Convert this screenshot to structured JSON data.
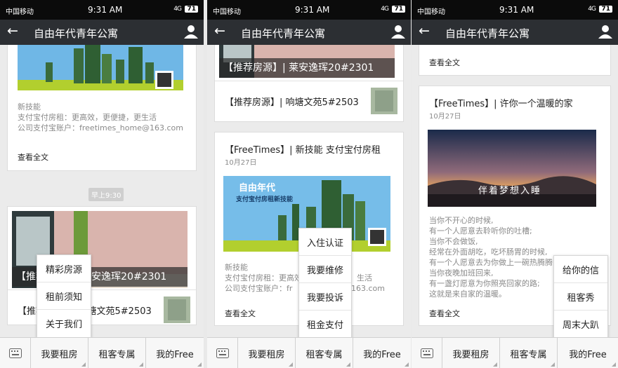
{
  "status": {
    "carrier": "中国移动",
    "time": "9:31 AM",
    "signal": "4G",
    "battery": "71"
  },
  "nav": {
    "title": "自由年代青年公寓"
  },
  "tabs": {
    "t1": "我要租房",
    "t2": "租客专属",
    "t3": "我的Free"
  },
  "left": {
    "card1_lines": [
      "新技能",
      "支付宝付房租：更高效，更便捷，更生活",
      "公司支付宝账户：freetimes_home@163.com"
    ],
    "readmore": "查看全文",
    "timestamp": "早上9:30",
    "overlay": "【推荐房源】| 莱安逸珲20#2301",
    "row_text": "【推荐房源】| 响塘文苑5#2503",
    "popup": [
      "精彩房源",
      "租前须知",
      "关于我们"
    ]
  },
  "middle": {
    "overlay": "【推荐房源】| 莱安逸珲20#2301",
    "row_text": "【推荐房源】| 响塘文苑5#2503",
    "card_title": "【FreeTimes】| 新技能  支付宝付房租",
    "date": "10月27日",
    "banner_brand": "自由年代",
    "banner_text": "支付宝付房租新技能",
    "lines": [
      "新技能",
      "支付宝付房租：更高效",
      "公司支付宝账户：fr"
    ],
    "line_tails": [
      "生活",
      "163.com"
    ],
    "readmore": "查看全文",
    "popup": [
      "入住认证",
      "我要维修",
      "我要投诉",
      "租金支付"
    ]
  },
  "right": {
    "readmore_top": "查看全文",
    "card_title": "【FreeTimes】| 许你一个温暖的家",
    "date": "10月27日",
    "image_caption": "伴着梦想入睡",
    "lines": [
      "当你不开心的时候,",
      "有一个人愿意去聆听你的吐槽;",
      "当你不会做饭,",
      "经常在外面胡吃，吃坏肠胃的时候,",
      "有一个人愿意去为你做上一碗热腾腾",
      "当你夜晚加班回来,",
      "有一盏灯愿意为你照亮回家的路;",
      "这就是来自家的温暖。"
    ],
    "readmore": "查看全文",
    "popup": [
      "给你的信",
      "租客秀",
      "周末大趴"
    ]
  },
  "colors": {
    "navbar": "#2c2f33",
    "statusbar": "#0b0b0b"
  }
}
